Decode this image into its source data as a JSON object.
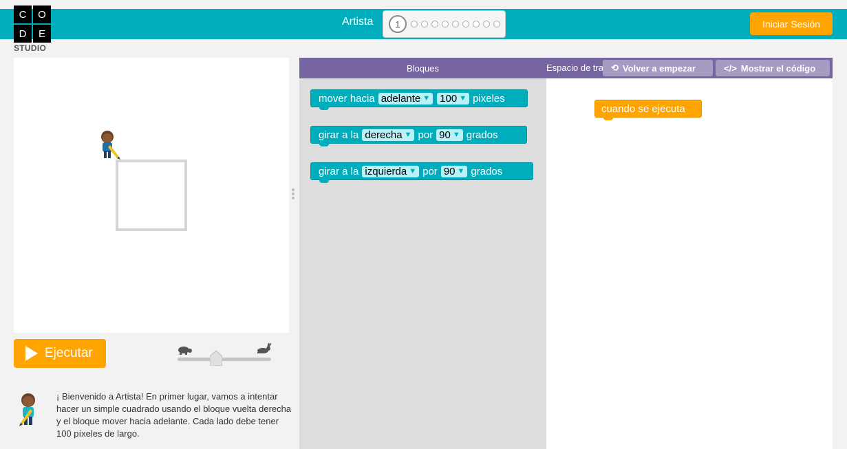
{
  "logo": {
    "letters": [
      "C",
      "O",
      "D",
      "E"
    ],
    "subtitle": "STUDIO"
  },
  "header": {
    "level_name": "Artista",
    "current_level": "1",
    "total_dots": 9,
    "signin_label": "Iniciar Sesión",
    "bar_color": "#00adbc"
  },
  "visualization": {
    "run_label": "Ejecutar",
    "speed_slow_icon": "turtle-icon",
    "speed_fast_icon": "rabbit-icon"
  },
  "instructions": {
    "text": "¡ Bienvenido a Artista! En primer lugar, vamos a intentar hacer un simple cuadrado usando el bloque vuelta derecha y el bloque mover hacia adelante. Cada lado debe tener 100 píxeles de largo."
  },
  "toolbox": {
    "header": "Bloques",
    "blocks": [
      {
        "pre": "mover hacia",
        "dd1": "adelante",
        "dd2": "100",
        "post": "pixeles"
      },
      {
        "pre": "girar a la",
        "dd1": "derecha",
        "mid": "por",
        "dd2": "90",
        "post": "grados"
      },
      {
        "pre": "girar a la",
        "dd1": "izquierda",
        "mid": "por",
        "dd2": "90",
        "post": "grados"
      }
    ]
  },
  "workspace": {
    "header": "Espacio de trabajo",
    "reset_label": "Volver a empezar",
    "show_code_label": "Mostrar el código",
    "event_block": "cuando se ejecuta"
  },
  "colors": {
    "accent": "#00adbc",
    "orange": "#ffa400",
    "purple": "#7665a0"
  }
}
